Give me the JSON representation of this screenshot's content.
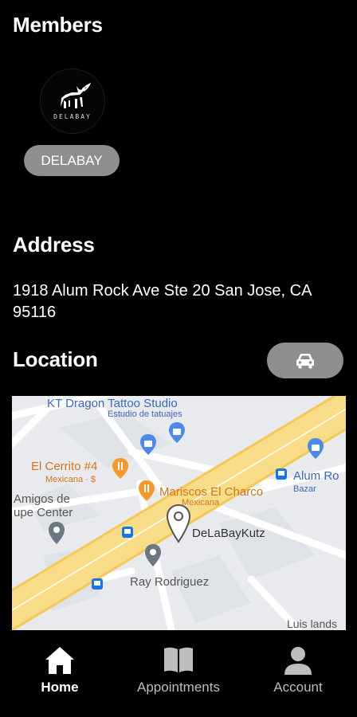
{
  "members": {
    "title": "Members",
    "items": [
      {
        "logo_text": "DELABAY",
        "name": "DELABAY"
      }
    ]
  },
  "address": {
    "title": "Address",
    "text": "1918 Alum Rock Ave Ste 20 San Jose, CA 95116"
  },
  "location": {
    "title": "Location",
    "directions_icon": "car-icon",
    "map": {
      "places": [
        {
          "name": "KT Dragon Tattoo Studio",
          "sub": "Estudio de tatuajes"
        },
        {
          "name": "El Cerrito #4",
          "sub": "Mexicana · $"
        },
        {
          "name": "Mariscos El Charco",
          "sub": "Mexicana"
        },
        {
          "name": "Alum Ro",
          "sub": "Bazar"
        },
        {
          "name": "Amigos de",
          "sub": ""
        },
        {
          "name": "upe Center",
          "sub": ""
        },
        {
          "name": "DeLaBayKutz",
          "sub": ""
        },
        {
          "name": "Ray Rodriguez",
          "sub": ""
        },
        {
          "name": "Luis lands",
          "sub": ""
        }
      ]
    }
  },
  "nav": {
    "items": [
      {
        "label": "Home",
        "icon": "home-icon",
        "active": true
      },
      {
        "label": "Appointments",
        "icon": "book-icon",
        "active": false
      },
      {
        "label": "Account",
        "icon": "person-icon",
        "active": false
      }
    ]
  },
  "colors": {
    "background": "#000000",
    "chip": "#8e8e8e",
    "road": "#f6d77a",
    "map_background": "#eceff1"
  }
}
